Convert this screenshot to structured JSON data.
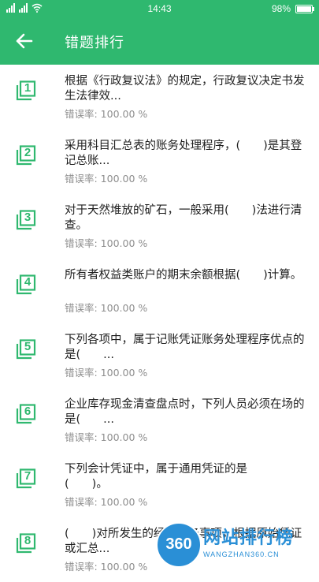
{
  "status_bar": {
    "carrier_icons": [
      "signal-icon",
      "signal-icon",
      "wifi-icon"
    ],
    "time": "14:43",
    "battery": "98%",
    "battery_level": 0.98
  },
  "header": {
    "title": "错题排行"
  },
  "rate_label": "错误率:",
  "questions": [
    {
      "number": "1",
      "text": "根据《行政复议法》的规定，行政复议决定书发生法律效...",
      "rate": "错误率:  100.00 %"
    },
    {
      "number": "2",
      "text": "采用科目汇总表的账务处理程序，(　　)是其登记总账...",
      "rate": "错误率:  100.00 %"
    },
    {
      "number": "3",
      "text": "对于天然堆放的矿石，一般采用(　　)法进行清查。",
      "rate": "错误率:  100.00 %"
    },
    {
      "number": "4",
      "text": "所有者权益类账户的期末余额根据(　　)计算。",
      "rate": "错误率:  100.00 %"
    },
    {
      "number": "5",
      "text": "下列各项中，属于记账凭证账务处理程序优点的是(　　...",
      "rate": "错误率:  100.00 %"
    },
    {
      "number": "6",
      "text": "企业库存现金清查盘点时，下列人员必须在场的是(　　...",
      "rate": "错误率:  100.00 %"
    },
    {
      "number": "7",
      "text": "下列会计凭证中，属于通用凭证的是\n(　　)。",
      "rate": "错误率:  100.00 %"
    },
    {
      "number": "8",
      "text": "(　　)对所发生的经济业务事项，根据原始凭证或汇总...",
      "rate": "错误率:  100.00 %"
    }
  ],
  "watermark": {
    "badge": "360",
    "title": "网站排行榜",
    "subtitle": "WANGZHAN360.CN"
  },
  "colors": {
    "accent": "#2fb86f",
    "text": "#1e1e1e",
    "muted": "#8e8e8e",
    "watermark": "#2a8fd6"
  }
}
